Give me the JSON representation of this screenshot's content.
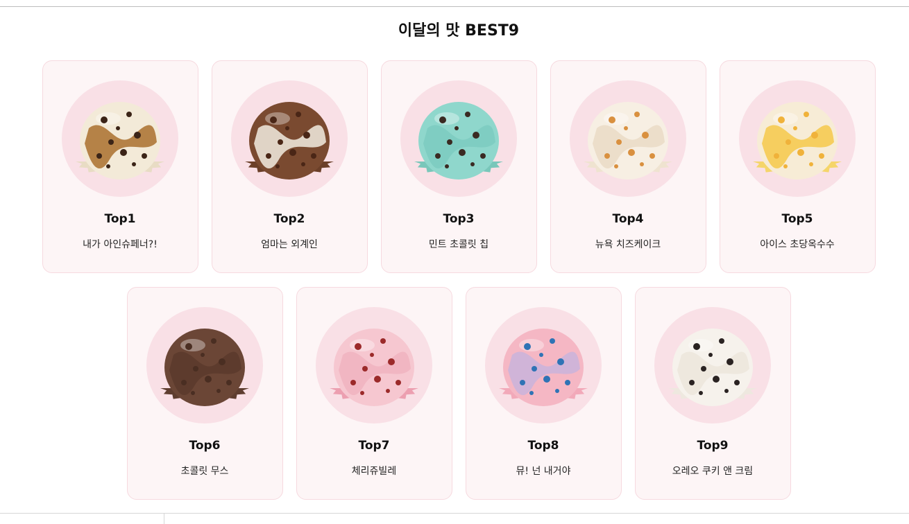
{
  "section": {
    "title": "이달의 맛 BEST9"
  },
  "items": [
    {
      "rank": "Top1",
      "name": "내가 아인슈페너?!",
      "icon": "vanilla-mocha-swirl-scoop-icon",
      "base": "#f3ead8",
      "swirl": "#a9702e",
      "dots": "#3b2417",
      "edge": "#e8dcc4"
    },
    {
      "rank": "Top2",
      "name": "엄마는 외계인",
      "icon": "chocolate-ball-scoop-icon",
      "base": "#7a4a30",
      "swirl": "#f2ece0",
      "dots": "#4a2616",
      "edge": "#6b3f28"
    },
    {
      "rank": "Top3",
      "name": "민트 초콜릿 칩",
      "icon": "mint-chocolate-chip-scoop-icon",
      "base": "#8fd7cc",
      "swirl": "#7dcbbf",
      "dots": "#3a2a22",
      "edge": "#79c7ba"
    },
    {
      "rank": "Top4",
      "name": "뉴욕 치즈케이크",
      "icon": "cheesecake-scoop-icon",
      "base": "#f7efe3",
      "swirl": "#eadbc6",
      "dots": "#d9903f",
      "edge": "#efe3d0"
    },
    {
      "rank": "Top5",
      "name": "아이스 초당옥수수",
      "icon": "sweet-corn-scoop-icon",
      "base": "#f7ecd6",
      "swirl": "#f6c94a",
      "dots": "#f0b23a",
      "edge": "#f5d56a"
    },
    {
      "rank": "Top6",
      "name": "초콜릿 무스",
      "icon": "chocolate-mousse-scoop-icon",
      "base": "#6b4636",
      "swirl": "#5b3a2c",
      "dots": "#4a2e22",
      "edge": "#5e3d2f"
    },
    {
      "rank": "Top7",
      "name": "체리쥬빌레",
      "icon": "cherry-jubilee-scoop-icon",
      "base": "#f6c7d0",
      "swirl": "#f0b3c0",
      "dots": "#9b2a2a",
      "edge": "#ec9fb0"
    },
    {
      "rank": "Top8",
      "name": "뮤! 넌 내거야",
      "icon": "pink-blue-candy-scoop-icon",
      "base": "#f5b7c4",
      "swirl": "#c9b4dc",
      "dots": "#2f73b5",
      "edge": "#f2a9b9"
    },
    {
      "rank": "Top9",
      "name": "오레오 쿠키 앤 크림",
      "icon": "cookies-and-cream-scoop-icon",
      "base": "#f6f2ec",
      "swirl": "#ece6dc",
      "dots": "#2a2322",
      "edge": "#eee8df"
    }
  ],
  "colors": {
    "card_bg": "#fdf5f6",
    "card_border": "#f6d9df",
    "circle_bg": "#f9e0e6"
  }
}
